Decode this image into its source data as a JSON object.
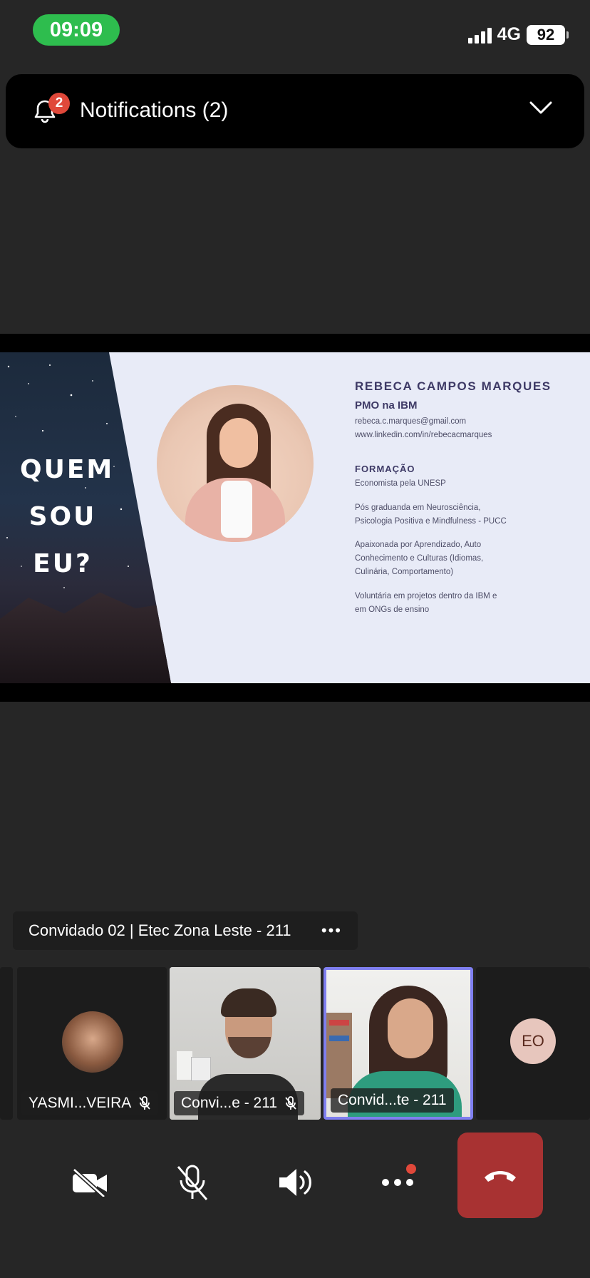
{
  "status_bar": {
    "time": "09:09",
    "network": "4G",
    "battery": "92"
  },
  "notifications": {
    "label": "Notifications (2)",
    "count": "2"
  },
  "slide": {
    "left_title_lines": [
      "QUEM",
      "SOU",
      "EU?"
    ],
    "name": "REBECA CAMPOS MARQUES",
    "role": "PMO na IBM",
    "email": "rebeca.c.marques@gmail.com",
    "linkedin": "www.linkedin.com/in/rebecacmarques",
    "formacao_heading": "FORMAÇÃO",
    "formacao_1": "Economista pela UNESP",
    "formacao_2a": "Pós graduanda em Neurosciência,",
    "formacao_2b": "Psicologia Positiva e Mindfulness - PUCC",
    "interests_a": "Apaixonada por Aprendizado, Auto",
    "interests_b": "Conhecimento e Culturas (Idiomas,",
    "interests_c": "Culinária, Comportamento)",
    "volunteer_a": "Voluntária em projetos dentro da IBM e",
    "volunteer_b": "em ONGs de ensino"
  },
  "speaker": {
    "name": "Convidado 02 | Etec Zona Leste - 211",
    "more": "•••"
  },
  "participants": [
    {
      "label": "YASMI...VEIRA",
      "muted": true
    },
    {
      "label": "Convi...e - 211",
      "muted": true
    },
    {
      "label": "Convid...te - 211",
      "muted": false
    },
    {
      "initials": "EO"
    }
  ],
  "colors": {
    "accent_green": "#2ebd4e",
    "end_call": "#a83232",
    "badge": "#e0483a",
    "active_border": "#7f7ff0"
  }
}
